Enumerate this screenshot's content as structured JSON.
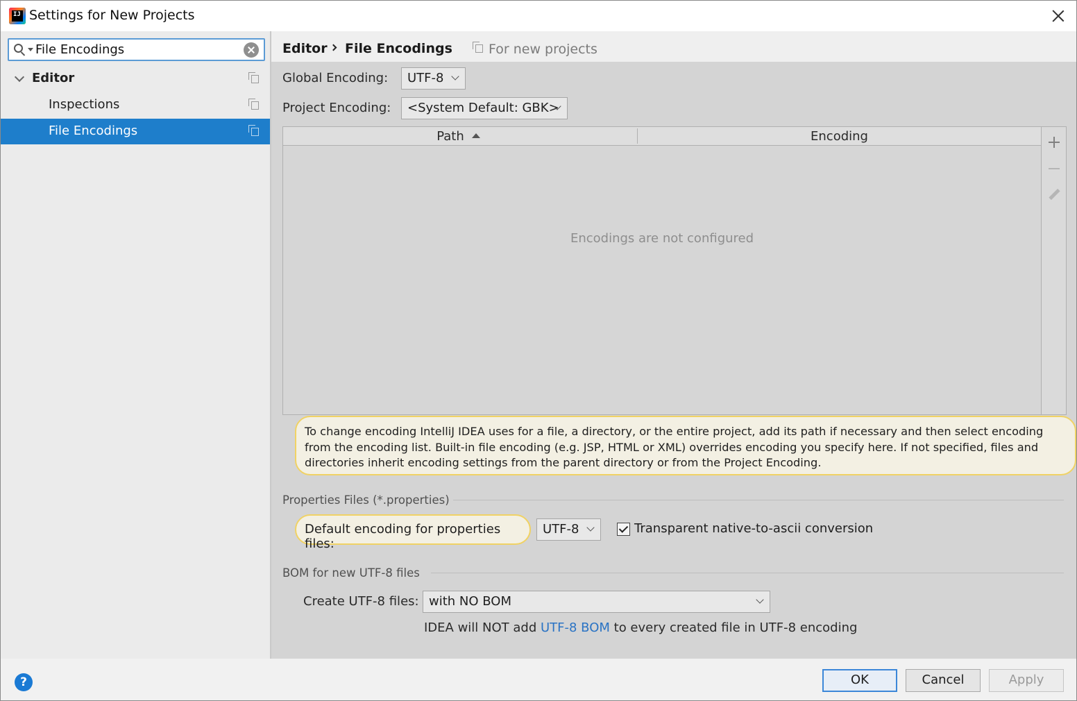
{
  "window": {
    "title": "Settings for New Projects",
    "app_icon_text": "IJ"
  },
  "search": {
    "value": "File Encodings",
    "placeholder": ""
  },
  "tree": {
    "items": [
      {
        "label": "Editor",
        "expanded": true,
        "level": 0,
        "selected": false
      },
      {
        "label": "Inspections",
        "level": 1,
        "selected": false
      },
      {
        "label": "File Encodings",
        "level": 1,
        "selected": true
      }
    ]
  },
  "breadcrumb": {
    "parent": "Editor",
    "current": "File Encodings",
    "scope_note": "For new projects"
  },
  "encodings": {
    "global_label": "Global Encoding:",
    "global_value": "UTF-8",
    "project_label": "Project Encoding:",
    "project_value": "<System Default: GBK>"
  },
  "table": {
    "columns": [
      "Path",
      "Encoding"
    ],
    "sort_column": "Path",
    "sort_direction": "ascending",
    "empty_text": "Encodings are not configured",
    "rows": []
  },
  "info_note": "To change encoding IntelliJ IDEA uses for a file, a directory, or the entire project, add its path if necessary and then select encoding from the encoding list. Built-in file encoding (e.g. JSP, HTML or XML) overrides encoding you specify here. If not specified, files and directories inherit encoding settings from the parent directory or from the Project Encoding.",
  "properties": {
    "section_title": "Properties Files (*.properties)",
    "default_label": "Default encoding for properties files:",
    "default_value": "UTF-8",
    "transparent_label": "Transparent native-to-ascii conversion",
    "transparent_checked": true
  },
  "bom": {
    "section_title": "BOM for new UTF-8 files",
    "create_label": "Create UTF-8 files:",
    "create_value": "with NO BOM",
    "desc_prefix": "IDEA will NOT add ",
    "desc_link": "UTF-8 BOM",
    "desc_suffix": " to every created file in UTF-8 encoding"
  },
  "footer": {
    "help": "?",
    "ok": "OK",
    "cancel": "Cancel",
    "apply": "Apply",
    "apply_enabled": false
  },
  "colors": {
    "selection": "#1e7ecb",
    "highlight_border": "#f0d264",
    "link": "#2a73c4",
    "help_blue": "#1a7ad4"
  }
}
